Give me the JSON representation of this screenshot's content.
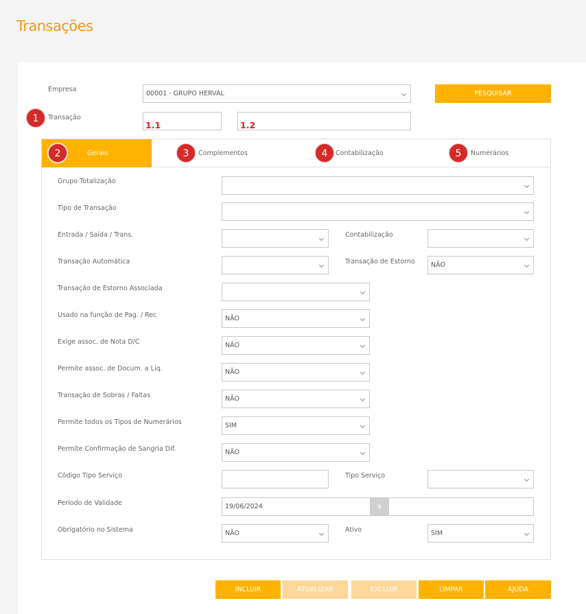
{
  "page": {
    "title": "Transações"
  },
  "search": {
    "empresa_label": "Empresa",
    "empresa_value": "00001 - GRUPO HERVAL",
    "transacao_label": "Transação",
    "transacao_code": "",
    "transacao_desc": "",
    "search_button": "PESQUISAR",
    "markers": {
      "m1": "1",
      "m11": "1.1",
      "m12": "1.2"
    }
  },
  "tabs": [
    {
      "label": "Gerais",
      "marker": "2"
    },
    {
      "label": "Complementos",
      "marker": "3"
    },
    {
      "label": "Contabilização",
      "marker": "4"
    },
    {
      "label": "Numerários",
      "marker": "5"
    }
  ],
  "form": {
    "grupo_totalizacao": {
      "label": "Grupo Totalização",
      "value": ""
    },
    "tipo_transacao": {
      "label": "Tipo de Transação",
      "value": ""
    },
    "entrada_saida": {
      "label": "Entrada / Saída / Trans.",
      "value": ""
    },
    "contabilizacao": {
      "label": "Contabilização",
      "value": ""
    },
    "transacao_automatica": {
      "label": "Transação Automática",
      "value": ""
    },
    "transacao_estorno": {
      "label": "Transação de Estorno",
      "value": "NÃO"
    },
    "estorno_associada": {
      "label": "Transação de Estorno Associada",
      "value": ""
    },
    "usado_pag_rec": {
      "label": "Usado na função de Pag. / Rec",
      "value": "NÃO"
    },
    "exige_nota": {
      "label": "Exige assoc. de Nota D/C",
      "value": "NÃO"
    },
    "permite_docum": {
      "label": "Permite assoc. de Docum. a Liq.",
      "value": "NÃO"
    },
    "sobras_faltas": {
      "label": "Transação de Sobras / Faltas",
      "value": "NÃO"
    },
    "todos_numerarios": {
      "label": "Permite todos os Tipos de Numerários",
      "value": "SIM"
    },
    "confirmacao_sangria": {
      "label": "Permite Confirmação de Sangria Dif.",
      "value": "NÃO"
    },
    "codigo_tipo_servico": {
      "label": "Código Tipo Serviço",
      "value": ""
    },
    "tipo_servico": {
      "label": "Tipo Serviço",
      "value": ""
    },
    "periodo_validade": {
      "label": "Período de Validade",
      "start": "19/06/2024",
      "sep": "a",
      "end": ""
    },
    "obrigatorio": {
      "label": "Obrigatório no Sistema",
      "value": "NÃO"
    },
    "ativo": {
      "label": "Ativo",
      "value": "SIM"
    }
  },
  "actions": {
    "incluir": "INCLUIR",
    "atualizar": "ATUALIZAR",
    "excluir": "EXCLUIR",
    "limpar": "LIMPAR",
    "ajuda": "AJUDA"
  },
  "colors": {
    "accent": "#ffb300",
    "title": "#f7941d",
    "marker": "#d42a2a"
  }
}
